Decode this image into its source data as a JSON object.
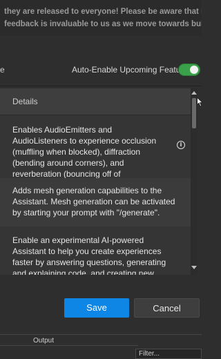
{
  "banner": {
    "line1": "they are released to everyone! Please be aware that Beta",
    "line2": "feedback is invaluable to us as we move towards building"
  },
  "auto_enable": {
    "cut_text": "e",
    "label": "Auto-Enable Upcoming Features",
    "toggle_on": true
  },
  "panel": {
    "details_label": "Details",
    "features": [
      {
        "description": "Enables AudioEmitters and AudioListeners to experience occlusion (muffling when blocked), diffraction (bending around corners), and reverberation (bouncing off of surroundings).",
        "info_icon": "info-icon"
      },
      {
        "description": "Adds mesh generation capabilities to the Assistant. Mesh generation can be activated by starting your prompt with \"/generate\"."
      },
      {
        "description": "Enable an experimental AI-powered Assistant to help you create experiences faster by answering questions, generating and explaining code, and creating new materials."
      }
    ]
  },
  "buttons": {
    "save_label": "Save",
    "cancel_label": "Cancel"
  },
  "bottom": {
    "output_label": "Output",
    "filter_placeholder": "Filter..."
  },
  "colors": {
    "accent": "#0e86e6",
    "toggle_on": "#3aa14a",
    "background": "#2e2e2e"
  }
}
